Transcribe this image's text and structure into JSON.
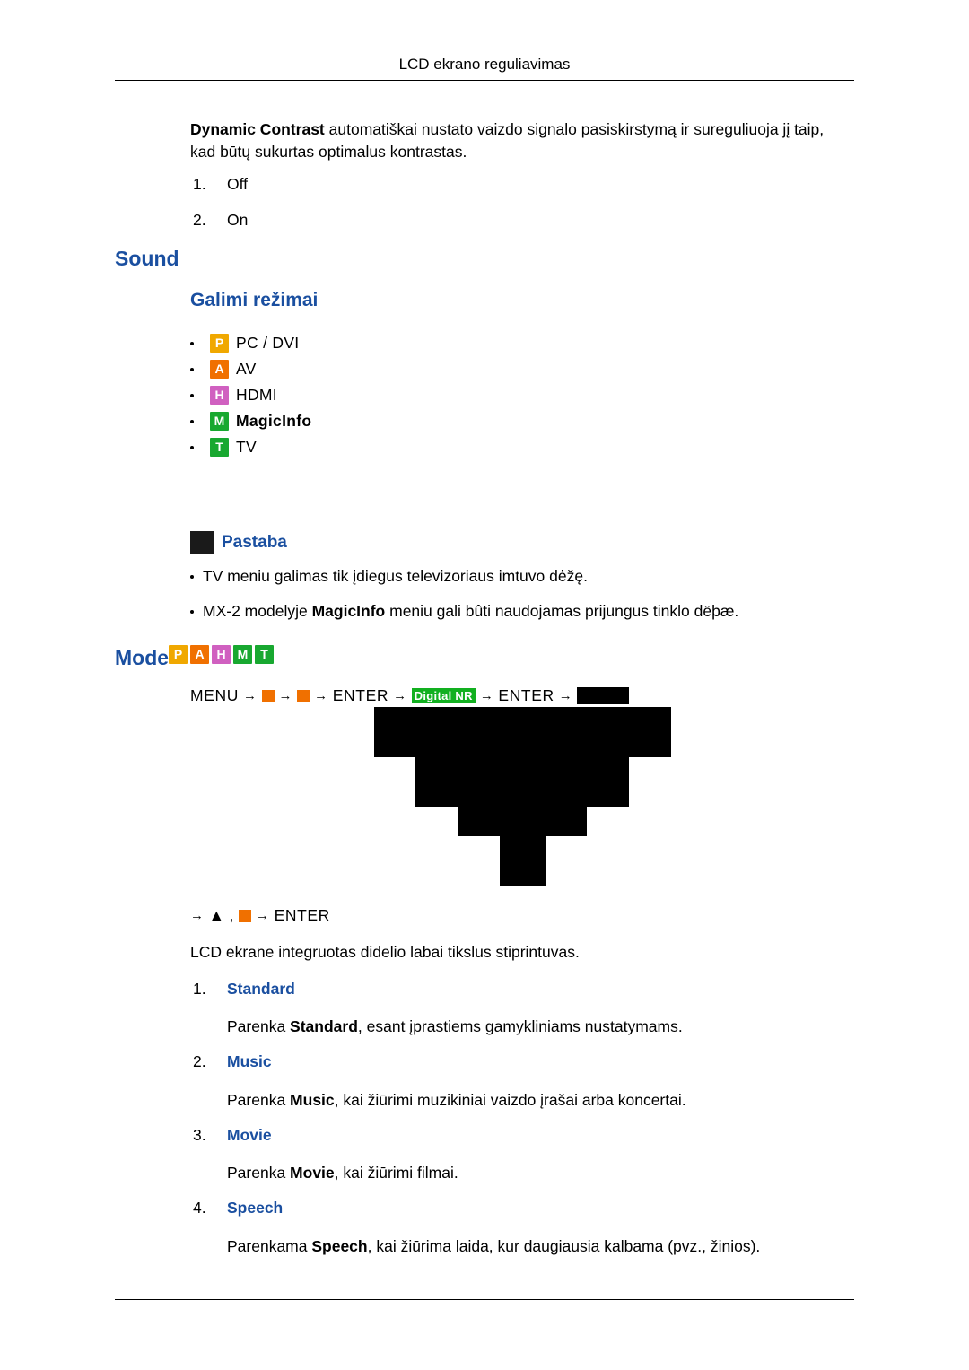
{
  "header": {
    "title": "LCD ekrano reguliavimas"
  },
  "intro": {
    "bold_lead": "Dynamic Contrast",
    "text": " automatiškai nustato vaizdo signalo pasiskirstymą ir sureguliuoja jį taip,",
    "line2": "kad būtų sukurtas optimalus kontrastas.",
    "options": [
      {
        "index": "1.",
        "label": "Off"
      },
      {
        "index": "2.",
        "label": "On"
      }
    ]
  },
  "sound": {
    "heading": "Sound",
    "subheading": "Galimi režimai",
    "modes": [
      {
        "chip": "P",
        "chip_color": "#f0a800",
        "label": "PC / DVI"
      },
      {
        "chip": "A",
        "chip_color": "#f07000",
        "label": "AV"
      },
      {
        "chip": "H",
        "chip_color": "#d060c0",
        "label": "HDMI"
      },
      {
        "chip": "M",
        "chip_color": "#18a830",
        "label": "MagicInfo"
      },
      {
        "chip": "T",
        "chip_color": "#18a830",
        "label": "TV"
      }
    ],
    "note": {
      "label": "Pastaba",
      "items": [
        "TV meniu galimas tik įdiegus televizoriaus imtuvo dėžę.",
        "MX-2 modelyje MagicInfo meniu gali bûti naudojamas prijungus tinklo dëþæ."
      ],
      "item2_parts": {
        "pre": "MX-2 modelyje ",
        "bold": "MagicInfo",
        "post": " meniu gali bûti naudojamas prijungus tinklo dëþæ."
      }
    }
  },
  "mode": {
    "heading": "Mode",
    "chips": [
      {
        "chip": "P",
        "chip_color": "#f0a800"
      },
      {
        "chip": "A",
        "chip_color": "#f07000"
      },
      {
        "chip": "H",
        "chip_color": "#d060c0"
      },
      {
        "chip": "M",
        "chip_color": "#18a830"
      },
      {
        "chip": "T",
        "chip_color": "#18a830"
      }
    ],
    "menu_path": {
      "menu": "MENU",
      "arrow": "→",
      "enter1": "ENTER",
      "tag": "Digital NR",
      "enter2": "ENTER",
      "comma": ","
    },
    "menu_path2": {
      "up_arrow": "▲",
      "comma": ",",
      "enter": "ENTER"
    },
    "description": "LCD ekrane integruotas didelio labai tikslus stiprintuvas.",
    "items": [
      {
        "index": "1.",
        "label": "Standard",
        "desc_pre": "Parenka ",
        "desc_bold": "Standard",
        "desc_post": ", esant įprastiems gamykliniams nustatymams."
      },
      {
        "index": "2.",
        "label": "Music",
        "desc_pre": "Parenka ",
        "desc_bold": "Music",
        "desc_post": ", kai žiūrimi muzikiniai vaizdo įrašai arba koncertai."
      },
      {
        "index": "3.",
        "label": "Movie",
        "desc_pre": "Parenka ",
        "desc_bold": "Movie",
        "desc_post": ", kai žiūrimi filmai."
      },
      {
        "index": "4.",
        "label": "Speech",
        "desc_pre": "Parenkama ",
        "desc_bold": "Speech",
        "desc_post": ", kai žiūrima laida, kur daugiausia kalbama (pvz., žinios)."
      }
    ]
  }
}
